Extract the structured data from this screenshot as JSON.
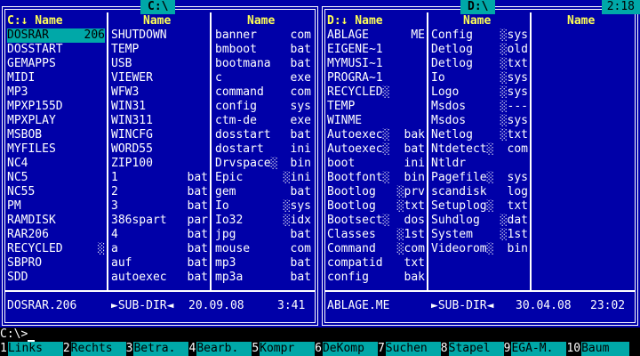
{
  "left_panel": {
    "title": "C:\\",
    "columns": [
      {
        "head": "C:↓ Name",
        "rows": [
          {
            "n": "DOSRAR",
            "e": "206",
            "sel": true
          },
          {
            "n": "DOSSTART",
            "e": ""
          },
          {
            "n": "GEMAPPS",
            "e": ""
          },
          {
            "n": "MIDI",
            "e": ""
          },
          {
            "n": "MP3",
            "e": ""
          },
          {
            "n": "MPXP155D",
            "e": ""
          },
          {
            "n": "MPXPLAY",
            "e": ""
          },
          {
            "n": "MSBOB",
            "e": ""
          },
          {
            "n": "MYFILES",
            "e": ""
          },
          {
            "n": "NC4",
            "e": ""
          },
          {
            "n": "NC5",
            "e": ""
          },
          {
            "n": "NC55",
            "e": ""
          },
          {
            "n": "PM",
            "e": ""
          },
          {
            "n": "RAMDISK",
            "e": ""
          },
          {
            "n": "RAR206",
            "e": ""
          },
          {
            "n": "RECYCLED",
            "e": "░"
          },
          {
            "n": "SBPRO",
            "e": ""
          },
          {
            "n": "SDD",
            "e": ""
          }
        ]
      },
      {
        "head": "Name",
        "rows": [
          {
            "n": "SHUTDOWN",
            "e": ""
          },
          {
            "n": "TEMP",
            "e": ""
          },
          {
            "n": "USB",
            "e": ""
          },
          {
            "n": "VIEWER",
            "e": ""
          },
          {
            "n": "WFW3",
            "e": ""
          },
          {
            "n": "WIN31",
            "e": ""
          },
          {
            "n": "WIN311",
            "e": ""
          },
          {
            "n": "WINCFG",
            "e": ""
          },
          {
            "n": "WORD55",
            "e": ""
          },
          {
            "n": "ZIP100",
            "e": ""
          },
          {
            "n": "1",
            "e": "bat"
          },
          {
            "n": "2",
            "e": "bat"
          },
          {
            "n": "3",
            "e": "bat"
          },
          {
            "n": "386spart",
            "e": "par"
          },
          {
            "n": "4",
            "e": "bat"
          },
          {
            "n": "a",
            "e": "bat"
          },
          {
            "n": "auf",
            "e": "bat"
          },
          {
            "n": "autoexec",
            "e": "bat"
          }
        ]
      },
      {
        "head": "Name",
        "rows": [
          {
            "n": "banner",
            "e": "com"
          },
          {
            "n": "bmboot",
            "e": "bat"
          },
          {
            "n": "bootmana",
            "e": "bat"
          },
          {
            "n": "c",
            "e": "exe"
          },
          {
            "n": "command",
            "e": "com"
          },
          {
            "n": "config",
            "e": "sys"
          },
          {
            "n": "ctm-de",
            "e": "exe"
          },
          {
            "n": "dosstart",
            "e": "bat"
          },
          {
            "n": "dostart",
            "e": "ini"
          },
          {
            "n": "Drvspace░",
            "e": "bin"
          },
          {
            "n": "Epic",
            "e": "░ini"
          },
          {
            "n": "gem",
            "e": "bat"
          },
          {
            "n": "Io",
            "e": "░sys"
          },
          {
            "n": "Io32",
            "e": "░idx"
          },
          {
            "n": "jpg",
            "e": "bat"
          },
          {
            "n": "mouse",
            "e": "com"
          },
          {
            "n": "mp3",
            "e": "bat"
          },
          {
            "n": "mp3a",
            "e": "bat"
          }
        ]
      }
    ],
    "status": {
      "name": "DOSRAR.206",
      "type": "►SUB-DIR◄",
      "date": "20.09.08",
      "time": "3:41"
    }
  },
  "right_panel": {
    "title": "D:\\",
    "clock": "2:18",
    "columns": [
      {
        "head": "D:↓ Name",
        "rows": [
          {
            "n": "ABLAGE",
            "e": "ME"
          },
          {
            "n": "EIGENE~1",
            "e": ""
          },
          {
            "n": "MYMUSI~1",
            "e": ""
          },
          {
            "n": "PROGRA~1",
            "e": ""
          },
          {
            "n": "RECYCLED░",
            "e": ""
          },
          {
            "n": "TEMP",
            "e": ""
          },
          {
            "n": "WINME",
            "e": ""
          },
          {
            "n": "Autoexec░",
            "e": "bak"
          },
          {
            "n": "Autoexec░",
            "e": "bat"
          },
          {
            "n": "boot",
            "e": "ini"
          },
          {
            "n": "Bootfont░",
            "e": "bin"
          },
          {
            "n": "Bootlog",
            "e": "░prv"
          },
          {
            "n": "Bootlog",
            "e": "░txt"
          },
          {
            "n": "Bootsect░",
            "e": "dos"
          },
          {
            "n": "Classes",
            "e": "░1st"
          },
          {
            "n": "Command",
            "e": "░com"
          },
          {
            "n": "compatid",
            "e": "txt"
          },
          {
            "n": "config",
            "e": "bak"
          }
        ]
      },
      {
        "head": "Name",
        "rows": [
          {
            "n": "Config",
            "e": "░sys"
          },
          {
            "n": "Detlog",
            "e": "░old"
          },
          {
            "n": "Detlog",
            "e": "░txt"
          },
          {
            "n": "Io",
            "e": "░sys"
          },
          {
            "n": "Logo",
            "e": "░sys"
          },
          {
            "n": "Msdos",
            "e": "░---"
          },
          {
            "n": "Msdos",
            "e": "░sys"
          },
          {
            "n": "Netlog",
            "e": "░txt"
          },
          {
            "n": "Ntdetect░",
            "e": "com"
          },
          {
            "n": "Ntldr",
            "e": ""
          },
          {
            "n": "Pagefile░",
            "e": "sys"
          },
          {
            "n": "scandisk",
            "e": "log"
          },
          {
            "n": "Setuplog░",
            "e": "txt"
          },
          {
            "n": "Suhdlog",
            "e": "░dat"
          },
          {
            "n": "System",
            "e": "░1st"
          },
          {
            "n": "Videorom░",
            "e": "bin"
          },
          {
            "n": "",
            "e": ""
          },
          {
            "n": "",
            "e": ""
          }
        ]
      },
      {
        "head": "Name",
        "rows": []
      }
    ],
    "status": {
      "name": "ABLAGE.ME",
      "type": "►SUB-DIR◄",
      "date": "30.04.08",
      "time": "23:02"
    }
  },
  "command_line": "C:\\>",
  "function_keys": [
    {
      "num": "1",
      "label": "Links"
    },
    {
      "num": "2",
      "label": "Rechts"
    },
    {
      "num": "3",
      "label": "Betra."
    },
    {
      "num": "4",
      "label": "Bearb."
    },
    {
      "num": "5",
      "label": "Kompr"
    },
    {
      "num": "6",
      "label": "DeKomp"
    },
    {
      "num": "7",
      "label": "Suchen"
    },
    {
      "num": "8",
      "label": "Stapel"
    },
    {
      "num": "9",
      "label": "EGA-M."
    },
    {
      "num": "10",
      "label": "Baum"
    }
  ],
  "colors": {
    "panel_bg": "#0000a8",
    "header_text": "#ffff55",
    "highlight_bg": "#00a8a8",
    "text": "#ffffff"
  }
}
